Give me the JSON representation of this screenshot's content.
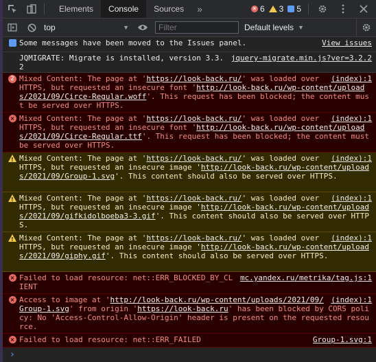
{
  "tabs": {
    "items": [
      "Elements",
      "Console",
      "Sources"
    ],
    "more": "»"
  },
  "counts": {
    "errors": "6",
    "warnings": "3",
    "issues": "5"
  },
  "toolbar": {
    "context": "top",
    "filter_placeholder": "Filter",
    "levels": "Default levels"
  },
  "messages": [
    {
      "type": "info",
      "text": "Some messages have been moved to the Issues panel.",
      "source": "View issues"
    },
    {
      "type": "log",
      "text": "JQMIGRATE: Migrate is installed, version 3.3.2",
      "source": "jquery-migrate.min.js?ver=3.2.2"
    },
    {
      "type": "error",
      "badge": "2",
      "pre": "Mixed Content: The page at '",
      "url1": "https://look-back.ru/",
      "mid": "' was loaded over HTTPS, but requested an insecure font '",
      "url2": "http://look-back.ru/wp-content/uploads/2021/09/Circe-Regular.woff",
      "post": "'. This request has been blocked; the content must be served over HTTPS.",
      "source": "(index):1"
    },
    {
      "type": "error",
      "pre": "Mixed Content: The page at '",
      "url1": "https://look-back.ru/",
      "mid": "' was loaded over HTTPS, but requested an insecure font '",
      "url2": "http://look-back.ru/wp-content/uploads/2021/09/Circe-Regular.ttf",
      "post": "'. This request has been blocked; the content must be served over HTTPS.",
      "source": "(index):1"
    },
    {
      "type": "warning",
      "pre": "Mixed Content: The page at '",
      "url1": "https://look-back.ru/",
      "mid": "' was loaded over HTTPS, but requested an insecure image '",
      "url2": "http://look-back.ru/wp-content/uploads/2021/09/Group-1.svg",
      "post": "'. This content should also be served over HTTPS.",
      "source": "(index):1"
    },
    {
      "type": "warning",
      "pre": "Mixed Content: The page at '",
      "url1": "https://look-back.ru/",
      "mid": "' was loaded over HTTPS, but requested an insecure image '",
      "url2": "http://look-back.ru/wp-content/uploads/2021/09/gifkidolboeba3-3.gif",
      "post": "'. This content should also be served over HTTPS.",
      "source": "(index):1"
    },
    {
      "type": "warning",
      "pre": "Mixed Content: The page at '",
      "url1": "https://look-back.ru/",
      "mid": "' was loaded over HTTPS, but requested an insecure image '",
      "url2": "http://look-back.ru/wp-content/uploads/2021/09/giphy.gif",
      "post": "'. This content should also be served over HTTPS.",
      "source": "(index):1"
    },
    {
      "type": "error",
      "text": "Failed to load resource: net::ERR_BLOCKED_BY_CLIENT",
      "source": "mc.yandex.ru/metrika/tag.js:1"
    },
    {
      "type": "error",
      "pre": "Access to image at '",
      "url1": "http://look-back.ru/wp-content/uploads/2021/09/Group-1.svg",
      "mid": "' from origin '",
      "url2": "https://look-back.ru",
      "post": "' has been blocked by CORS policy: No 'Access-Control-Allow-Origin' header is present on the requested resource.",
      "source": "(index):1"
    },
    {
      "type": "error",
      "text": "Failed to load resource: net::ERR_FAILED",
      "source": "Group-1.svg:1"
    }
  ],
  "prompt": "›",
  "colors": {
    "error_bg": "#290000",
    "warning_bg": "#332b00",
    "error_text": "#f28b82",
    "warning_text": "#f2e8c6",
    "accent": "#5e9bf5"
  }
}
